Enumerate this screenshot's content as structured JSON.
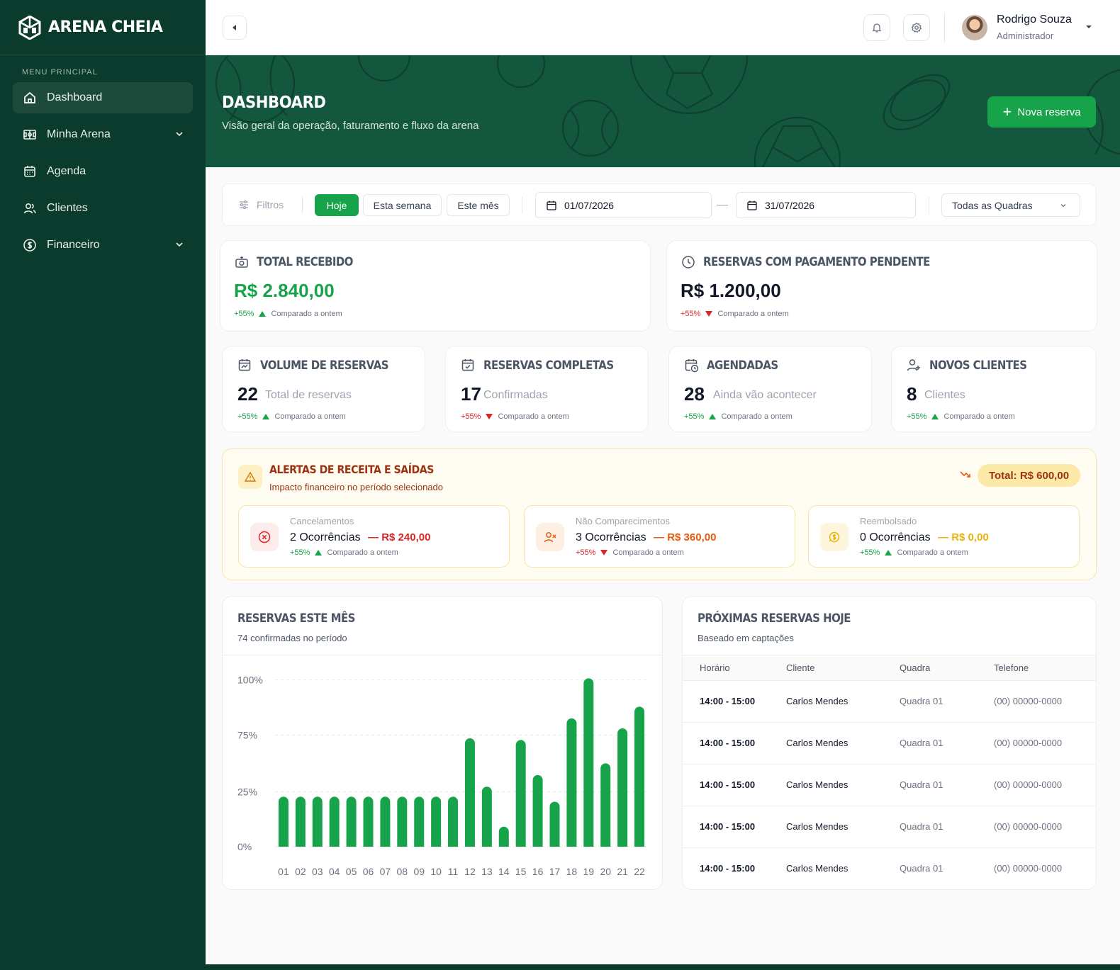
{
  "brand": {
    "name": "ARENA CHEIA",
    "accent": "#16a34a",
    "sidebar_bg": "#0b3b2c",
    "hero_bg": "#14573f"
  },
  "sidebar": {
    "section_label": "MENU PRINCIPAL",
    "items": [
      {
        "label": "Dashboard",
        "icon": "home-icon",
        "active": true
      },
      {
        "label": "Minha Arena",
        "icon": "field-icon",
        "has_submenu": true
      },
      {
        "label": "Agenda",
        "icon": "calendar-icon"
      },
      {
        "label": "Clientes",
        "icon": "users-icon"
      },
      {
        "label": "Financeiro",
        "icon": "dollar-icon",
        "has_submenu": true
      }
    ]
  },
  "topbar": {
    "user": {
      "name": "Rodrigo Souza",
      "role": "Administrador"
    }
  },
  "hero": {
    "title": "DASHBOARD",
    "subtitle": "Visão geral da operação, faturamento e fluxo da arena",
    "cta": "Nova reserva"
  },
  "filters": {
    "label": "Filtros",
    "periods": [
      "Hoje",
      "Esta semana",
      "Este mês"
    ],
    "active_period": "Hoje",
    "date_from": "01/07/2026",
    "date_to": "31/07/2026",
    "court_select": "Todas as Quadras"
  },
  "kpis": {
    "total_received": {
      "title": "TOTAL RECEBIDO",
      "value": "R$ 2.840,00",
      "pct": "+55%",
      "trend": "up",
      "compare": "Comparado a ontem"
    },
    "pending": {
      "title": "RESERVAS COM PAGAMENTO PENDENTE",
      "value": "R$ 1.200,00",
      "pct": "+55%",
      "trend": "down",
      "compare": "Comparado a ontem"
    }
  },
  "stats": [
    {
      "title": "VOLUME DE RESERVAS",
      "value": "22",
      "desc": "Total de reservas",
      "pct": "+55%",
      "trend": "up",
      "compare": "Comparado a ontem"
    },
    {
      "title": "RESERVAS COMPLETAS",
      "value": "17",
      "desc": "Confirmadas",
      "pct": "+55%",
      "trend": "down",
      "compare": "Comparado a ontem"
    },
    {
      "title": "AGENDADAS",
      "value": "28",
      "desc": "Ainda vão acontecer",
      "pct": "+55%",
      "trend": "up",
      "compare": "Comparado a ontem"
    },
    {
      "title": "NOVOS CLIENTES",
      "value": "8",
      "desc": "Clientes",
      "pct": "+55%",
      "trend": "up",
      "compare": "Comparado a ontem"
    }
  ],
  "alerts": {
    "title": "ALERTAS DE RECEITA E SAÍDAS",
    "subtitle": "Impacto financeiro no período selecionado",
    "total": "Total: R$ 600,00",
    "items": [
      {
        "label": "Cancelamentos",
        "count": "2 Ocorrências",
        "amount": "R$ 240,00",
        "amount_color": "#dc2626",
        "pct": "+55%",
        "trend": "up",
        "compare": "Comparado a ontem"
      },
      {
        "label": "Não Comparecimentos",
        "count": "3 Ocorrências",
        "amount": "R$ 360,00",
        "amount_color": "#ea580c",
        "pct": "+55%",
        "trend": "down",
        "compare": "Comparado a ontem"
      },
      {
        "label": "Reembolsado",
        "count": "0 Ocorrências",
        "amount": "R$ 0,00",
        "amount_color": "#eab308",
        "pct": "+55%",
        "trend": "up",
        "compare": "Comparado a ontem"
      }
    ]
  },
  "chart_section": {
    "title": "RESERVAS ESTE MÊS",
    "subtitle": "74 confirmadas no período"
  },
  "chart_data": {
    "type": "bar",
    "categories": [
      "01",
      "02",
      "03",
      "04",
      "05",
      "06",
      "07",
      "08",
      "09",
      "10",
      "11",
      "12",
      "13",
      "14",
      "15",
      "16",
      "17",
      "18",
      "19",
      "20",
      "21",
      "22"
    ],
    "values": [
      30,
      30,
      30,
      30,
      30,
      30,
      30,
      30,
      30,
      30,
      30,
      65,
      36,
      12,
      64,
      43,
      27,
      77,
      101,
      50,
      71,
      84
    ],
    "yticks": [
      {
        "label": "100%",
        "value": 100
      },
      {
        "label": "75%",
        "value": 67
      },
      {
        "label": "25%",
        "value": 33
      },
      {
        "label": "0%",
        "value": 0
      }
    ],
    "ylim": [
      0,
      102
    ],
    "grid": true,
    "bar_color": "#16a34a"
  },
  "table": {
    "title": "PRÓXIMAS RESERVAS HOJE",
    "subtitle": "Baseado em captações",
    "columns": [
      "Horário",
      "Cliente",
      "Quadra",
      "Telefone"
    ],
    "rows": [
      [
        "14:00 - 15:00",
        "Carlos Mendes",
        "Quadra 01",
        "(00) 00000-0000"
      ],
      [
        "14:00 - 15:00",
        "Carlos Mendes",
        "Quadra 01",
        "(00) 00000-0000"
      ],
      [
        "14:00 - 15:00",
        "Carlos Mendes",
        "Quadra 01",
        "(00) 00000-0000"
      ],
      [
        "14:00 - 15:00",
        "Carlos Mendes",
        "Quadra 01",
        "(00) 00000-0000"
      ],
      [
        "14:00 - 15:00",
        "Carlos Mendes",
        "Quadra 01",
        "(00) 00000-0000"
      ]
    ]
  }
}
